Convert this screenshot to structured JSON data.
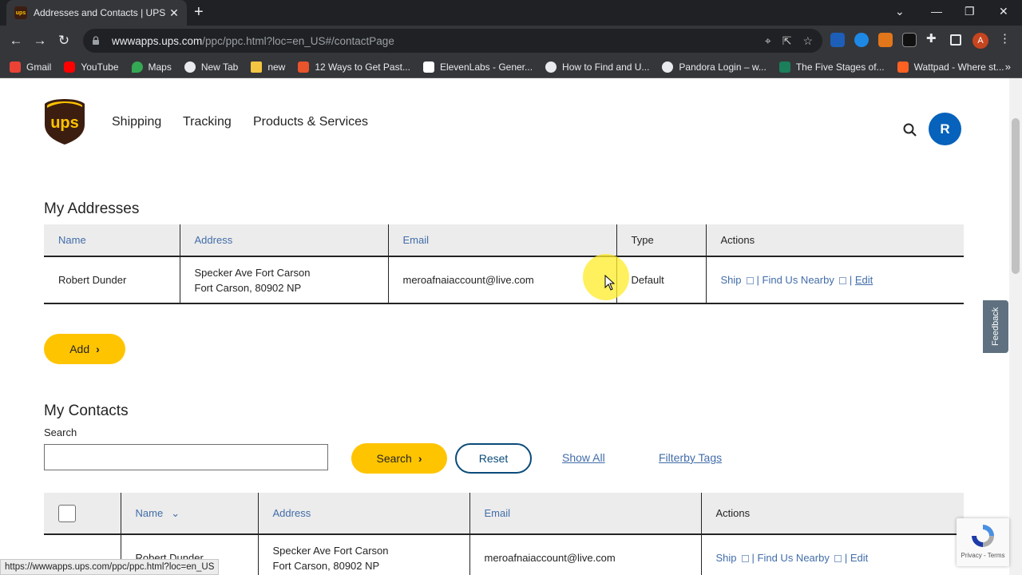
{
  "browser": {
    "tab_title": "Addresses and Contacts | UPS",
    "url_host": "wwwapps.ups.com",
    "url_path": "/ppc/ppc.html?loc=en_US#/contactPage",
    "profile_initial": "A",
    "bookmarks": [
      {
        "label": "Gmail",
        "color": "#ea4335"
      },
      {
        "label": "YouTube",
        "color": "#ff0000"
      },
      {
        "label": "Maps",
        "color": "#34a853"
      },
      {
        "label": "New Tab",
        "color": "#e8eaed"
      },
      {
        "label": "new",
        "color": "#f4c542"
      },
      {
        "label": "12 Ways to Get Past...",
        "color": "#e8542b"
      },
      {
        "label": "ElevenLabs - Gener...",
        "color": "#ffffff"
      },
      {
        "label": "How to Find and U...",
        "color": "#e8eaed"
      },
      {
        "label": "Pandora Login – w...",
        "color": "#e8eaed"
      },
      {
        "label": "The Five Stages of...",
        "color": "#1a7f5a"
      },
      {
        "label": "Wattpad - Where st...",
        "color": "#ff6122"
      }
    ],
    "status_url": "https://wwwapps.ups.com/ppc/ppc.html?loc=en_US"
  },
  "header": {
    "logo_text": "ups",
    "nav": [
      "Shipping",
      "Tracking",
      "Products & Services"
    ],
    "avatar_initial": "R"
  },
  "addresses": {
    "title": "My Addresses",
    "columns": [
      "Name",
      "Address",
      "Email",
      "Type",
      "Actions"
    ],
    "rows": [
      {
        "name": "Robert Dunder",
        "address_line1": "Specker Ave Fort Carson",
        "address_line2": "Fort Carson,  80902 NP",
        "email": "meroafnaiaccount@live.com",
        "type": "Default",
        "action_ship": "Ship",
        "action_find": "Find Us Nearby",
        "action_edit": "Edit"
      }
    ],
    "add_label": "Add"
  },
  "contacts": {
    "title": "My Contacts",
    "search_label": "Search",
    "search_value": "",
    "search_button": "Search",
    "reset_button": "Reset",
    "show_all": "Show All",
    "filter_tags": "Filterby Tags",
    "columns": [
      "Name",
      "Address",
      "Email",
      "Actions"
    ],
    "rows": [
      {
        "name": "Robert Dunder",
        "address_line1": "Specker Ave Fort Carson",
        "address_line2": "Fort Carson,  80902 NP",
        "email": "meroafnaiaccount@live.com",
        "action_ship": "Ship",
        "action_find": "Find Us Nearby",
        "action_edit": "Edit"
      }
    ]
  },
  "feedback_label": "Feedback",
  "recaptcha_text": "Privacy - Terms"
}
